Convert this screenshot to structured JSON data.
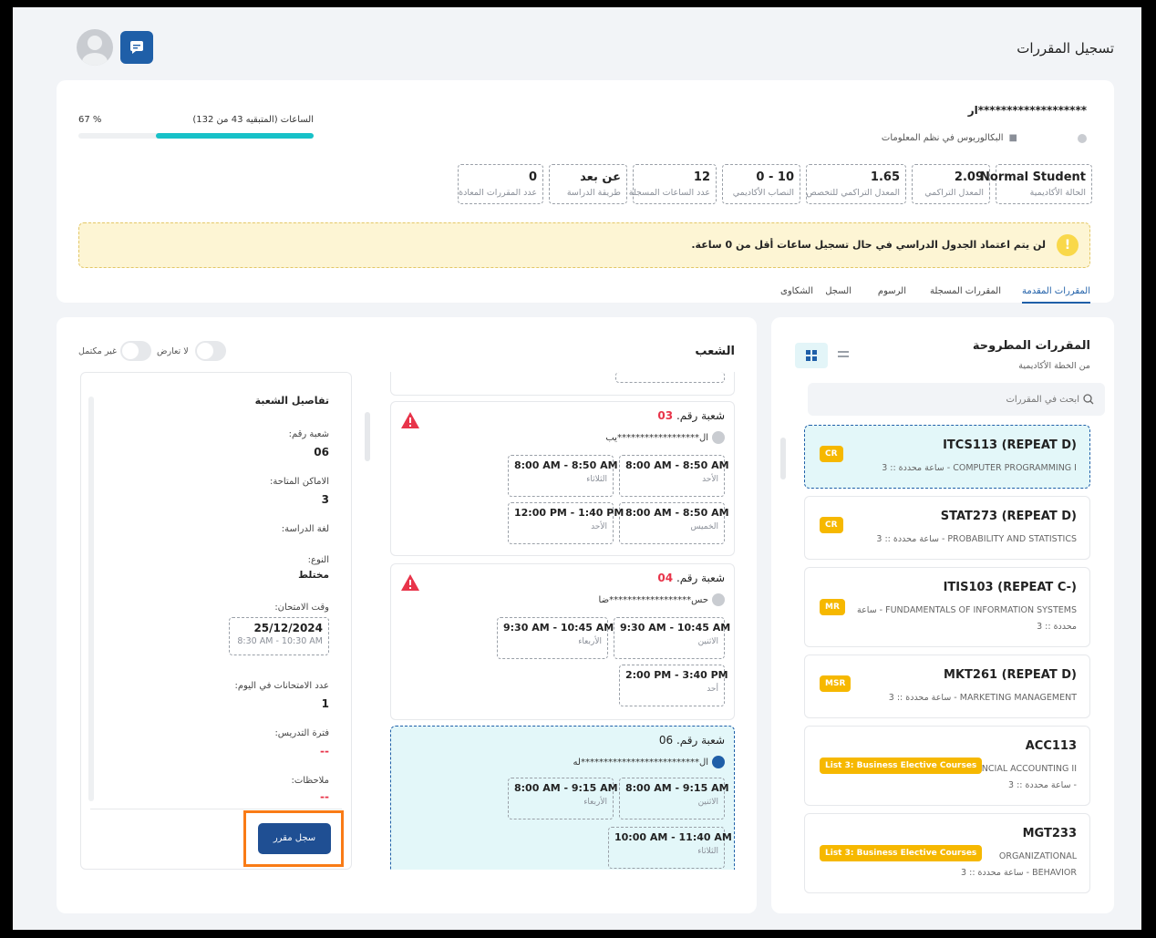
{
  "header": {
    "title": "تسجيل المقررات"
  },
  "student": {
    "name": "*******************ار",
    "program": "البكالوريوس في نظم المعلومات",
    "hours_label": "الساعات (المتبقيه 43 من 132)",
    "hours_percent_text": "67 %",
    "progress_fraction": 0.67
  },
  "stats": [
    {
      "value": "Normal Student",
      "label": "الحالة الأكاديمية"
    },
    {
      "value": "2.09",
      "label": "المعدل التراكمي"
    },
    {
      "value": "1.65",
      "label": "المعدل التراكمي للتخصص"
    },
    {
      "value": "10 - 0",
      "label": "النصاب الأكاديمي"
    },
    {
      "value": "12",
      "label": "عدد الساعات المسجلة"
    },
    {
      "value": "عن بعد",
      "label": "طريقة الدراسة"
    },
    {
      "value": "0",
      "label": "عدد المقررات المعادة"
    }
  ],
  "warning": "لن يتم اعتماد الجدول الدراسي في حال تسجيل ساعات أقل من 0 ساعة.",
  "tabs": [
    "المقررات المقدمة",
    "المقررات المسجلة",
    "الرسوم",
    "السجل",
    "الشكاوى"
  ],
  "courses_panel": {
    "title": "المقررات المطروحة",
    "subtitle": "من الخطة الأكاديمية",
    "search_placeholder": "ابحث في المقررات",
    "courses": [
      {
        "code": "ITCS113 (REPEAT D)",
        "name": "COMPUTER PROGRAMMING I - ساعة محددة :: 3",
        "badge": "CR"
      },
      {
        "code": "STAT273 (REPEAT D)",
        "name": "PROBABILITY AND STATISTICS - ساعة محددة :: 3",
        "badge": "CR"
      },
      {
        "code": "ITIS103 (REPEAT C-)",
        "name": "FUNDAMENTALS OF INFORMATION SYSTEMS - ساعة محددة :: 3",
        "badge": "MR"
      },
      {
        "code": "MKT261 (REPEAT D)",
        "name": "MARKETING MANAGEMENT - ساعة محددة :: 3",
        "badge": "MSR"
      },
      {
        "code": "ACC113",
        "name": "FINANCIAL ACCOUNTING II - ساعة محددة :: 3",
        "badge": "List 3: Business Elective Courses"
      },
      {
        "code": "MGT233",
        "name": "ORGANIZATIONAL BEHAVIOR - ساعة محددة :: 3",
        "badge": "List 3: Business Elective Courses"
      }
    ]
  },
  "sections_panel": {
    "title": "الشعب",
    "toggle_no_conflict": "لا تعارض",
    "toggle_not_full": "غير مكتمل",
    "section_prefix": "شعبة رقم.",
    "sections": [
      {
        "number": "03",
        "instructor": "ال******************يب",
        "slots": [
          {
            "time": "8:00 AM - 8:50 AM",
            "day": "الأحد"
          },
          {
            "time": "8:00 AM - 8:50 AM",
            "day": "الثلاثاء"
          },
          {
            "time": "8:00 AM - 8:50 AM",
            "day": "الخميس"
          },
          {
            "time": "12:00 PM - 1:40 PM",
            "day": "الأحد"
          }
        ]
      },
      {
        "number": "04",
        "instructor": "حس******************ضا",
        "slots": [
          {
            "time": "9:30 AM - 10:45 AM",
            "day": "الاثنين"
          },
          {
            "time": "9:30 AM - 10:45 AM",
            "day": "الأربعاء"
          },
          {
            "time": "2:00 PM - 3:40 PM",
            "day": "أحد"
          }
        ]
      },
      {
        "number": "06",
        "instructor": "ال**************************له",
        "slots": [
          {
            "time": "8:00 AM - 9:15 AM",
            "day": "الاثنين"
          },
          {
            "time": "8:00 AM - 9:15 AM",
            "day": "الأربعاء"
          },
          {
            "time": "10:00 AM - 11:40 AM",
            "day": "الثلاثاء"
          }
        ]
      }
    ]
  },
  "details": {
    "title": "تفاصيل الشعبة",
    "section_label": "شعبة رقم:",
    "section_value": "06",
    "seats_label": "الاماكن المتاحة:",
    "seats_value": "3",
    "language_label": "لغة الدراسة:",
    "type_label": "النوع:",
    "type_value": "مختلط",
    "exam_label": "وقت الامتحان:",
    "exam_date": "25/12/2024",
    "exam_time": "8:30 AM - 10:30 AM",
    "exams_per_day_label": "عدد الامتحانات في اليوم:",
    "exams_per_day_value": "1",
    "teaching_period_label": "فترة التدريس:",
    "teaching_period_value": "--",
    "notes_label": "ملاحظات:",
    "notes_value": "--",
    "register_button": "سجل مقرر"
  },
  "colors": {
    "primary": "#1f5fa8",
    "accent_teal": "#17c1c8",
    "badge": "#f6b800",
    "danger": "#e8344a",
    "highlight": "#f97b16"
  }
}
